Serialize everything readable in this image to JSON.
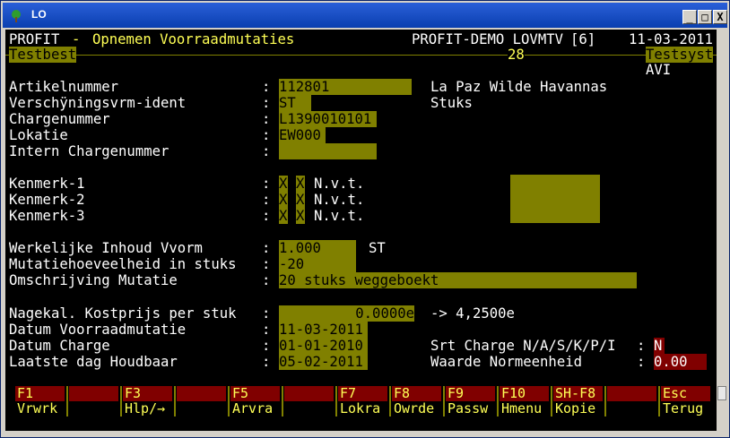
{
  "window": {
    "title": "LO",
    "minimize": "_",
    "maximize": "□",
    "close": "X"
  },
  "header": {
    "app": "PROFIT",
    "dash": "-",
    "screen_title": "Opnemen Voorraadmutaties",
    "env": "PROFIT-DEMO LOVMTV",
    "session": "[6]",
    "date": "11-03-2011",
    "left_tag": "Testbest",
    "number": "28",
    "right_tag": "Testsyst",
    "sub": "AVI"
  },
  "fields": {
    "artikelnummer": {
      "label": "Artikelnummer",
      "value": "112801",
      "desc": "La Paz Wilde Havannas"
    },
    "verschijningsvorm": {
      "label": "Verschÿningsvrm-ident",
      "value": "ST",
      "desc": "Stuks"
    },
    "chargenummer": {
      "label": "Chargenummer",
      "value": "L1390010101"
    },
    "lokatie": {
      "label": "Lokatie",
      "value": "EW000"
    },
    "intern": {
      "label": "Intern Chargenummer",
      "value": ""
    },
    "kenmerk1": {
      "label": "Kenmerk-1",
      "a": "X",
      "b": "X",
      "text": "N.v.t."
    },
    "kenmerk2": {
      "label": "Kenmerk-2",
      "a": "X",
      "b": "X",
      "text": "N.v.t."
    },
    "kenmerk3": {
      "label": "Kenmerk-3",
      "a": "X",
      "b": "X",
      "text": "N.v.t."
    },
    "inhoud": {
      "label": "Werkelijke Inhoud Vvorm",
      "value": "1.000",
      "unit": "ST"
    },
    "mutatie": {
      "label": "Mutatiehoeveelheid in stuks",
      "value": "-20"
    },
    "omschrijving": {
      "label": "Omschrijving Mutatie",
      "value": "20 stuks weggeboekt"
    },
    "kostprijs": {
      "label": "Nagekal. Kostprijs per stuk",
      "value": "0.0000e",
      "arrow": "-> 4,2500e"
    },
    "datum_mut": {
      "label": "Datum Voorraadmutatie",
      "value": "11-03-2011"
    },
    "datum_charge": {
      "label": "Datum Charge",
      "value": "01-01-2010"
    },
    "houdbaar": {
      "label": "Laatste dag Houdbaar",
      "value": "05-02-2011"
    },
    "srt_charge": {
      "label": "Srt Charge N/A/S/K/P/I",
      "value": "N"
    },
    "waarde": {
      "label": "Waarde Normeenheid",
      "value": "0.00"
    }
  },
  "colon": ":",
  "fkeys": [
    {
      "key": "F1",
      "label": "Vrwrk"
    },
    {
      "key": "",
      "label": ""
    },
    {
      "key": "F3",
      "label": "Hlp/→"
    },
    {
      "key": "",
      "label": ""
    },
    {
      "key": "F5",
      "label": "Arvra"
    },
    {
      "key": "",
      "label": ""
    },
    {
      "key": "F7",
      "label": "Lokra"
    },
    {
      "key": "F8",
      "label": "Owrde"
    },
    {
      "key": "F9",
      "label": "Passw"
    },
    {
      "key": "F10",
      "label": "Hmenu"
    },
    {
      "key": "SH-F8",
      "label": "Kopie"
    },
    {
      "key": "",
      "label": ""
    },
    {
      "key": "Esc",
      "label": "Terug"
    }
  ],
  "colors": {
    "olive": "#808000",
    "maroon": "#800000",
    "yellow": "#ffff55",
    "title_bar": "#0a3fb0"
  }
}
